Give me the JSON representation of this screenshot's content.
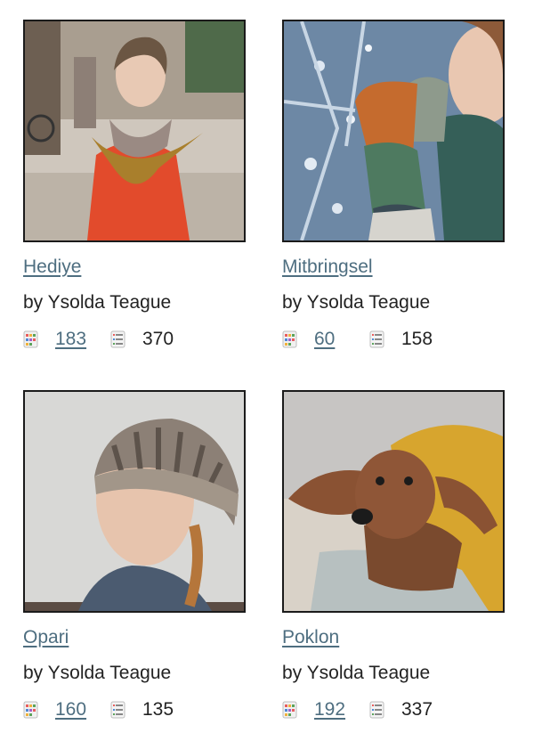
{
  "patterns": [
    {
      "name": "Hediye",
      "author": "by Ysolda Teague",
      "projects": "183",
      "queued": "370"
    },
    {
      "name": "Mitbringsel",
      "author": "by Ysolda Teague",
      "projects": "60",
      "queued": "158"
    },
    {
      "name": "Opari",
      "author": "by Ysolda Teague",
      "projects": "160",
      "queued": "135"
    },
    {
      "name": "Poklon",
      "author": "by Ysolda Teague",
      "projects": "192",
      "queued": "337"
    }
  ],
  "icons": {
    "projects": "projects-icon",
    "queue": "queue-icon"
  },
  "colors": {
    "link": "#4e6e80",
    "border": "#1b1b1b"
  }
}
